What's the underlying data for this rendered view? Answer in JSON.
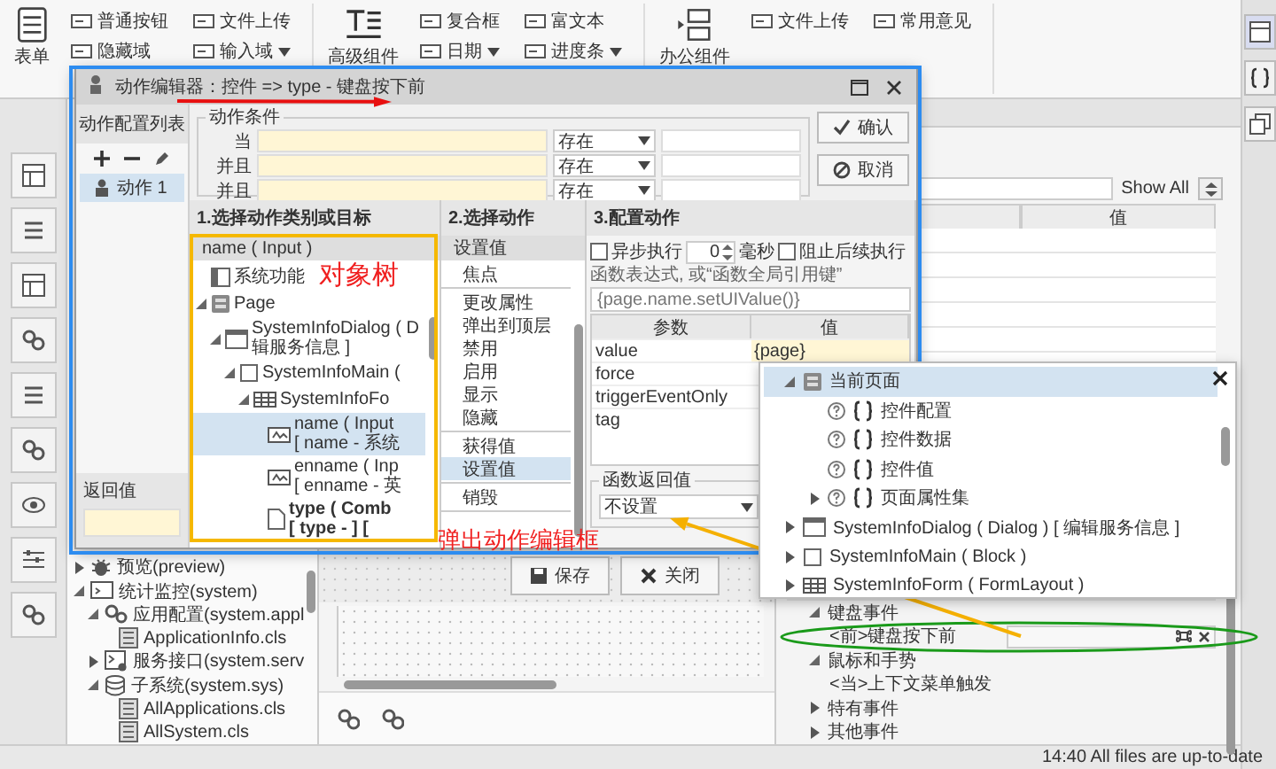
{
  "ribbon": {
    "groups": [
      {
        "label": "表单",
        "items": [
          {
            "label": "普通按钮",
            "has_menu": false
          },
          {
            "label": "文件上传",
            "has_menu": false
          },
          {
            "label": "隐藏域",
            "has_menu": false
          },
          {
            "label": "输入域",
            "has_menu": true
          }
        ]
      },
      {
        "label": "高级组件",
        "items": [
          {
            "label": "复合框",
            "has_menu": false
          },
          {
            "label": "富文本",
            "has_menu": false
          },
          {
            "label": "日期",
            "has_menu": true
          },
          {
            "label": "进度条",
            "has_menu": true
          }
        ]
      },
      {
        "label": "办公组件",
        "items": [
          {
            "label": "文件上传",
            "has_menu": false
          },
          {
            "label": "常用意见",
            "has_menu": false
          }
        ]
      }
    ]
  },
  "project_tree": {
    "items": [
      {
        "label": "预览(preview)",
        "kind": "preview",
        "expanded": false
      },
      {
        "label": "统计监控(system)",
        "kind": "monitor",
        "expanded": true,
        "children": [
          {
            "label": "应用配置(system.appl",
            "kind": "config",
            "expanded": true,
            "children": [
              {
                "label": "ApplicationInfo.cls",
                "kind": "class"
              }
            ]
          },
          {
            "label": "服务接口(system.serv",
            "kind": "service",
            "expanded": false
          },
          {
            "label": "子系统(system.sys)",
            "kind": "database",
            "expanded": true,
            "children": [
              {
                "label": "AllApplications.cls",
                "kind": "class"
              },
              {
                "label": "AllSystem.cls",
                "kind": "class"
              }
            ]
          }
        ]
      }
    ]
  },
  "properties": {
    "show_all": "Show All",
    "value_column": "值",
    "events": [
      {
        "label": "键盘事件",
        "kind": "group",
        "expanded": true
      },
      {
        "label": "<前>键盘按下前",
        "kind": "bound"
      },
      {
        "label": "鼠标和手势",
        "kind": "group",
        "expanded": true
      },
      {
        "label": "<当>上下文菜单触发",
        "kind": "event"
      },
      {
        "label": "特有事件",
        "kind": "group",
        "expanded": false
      },
      {
        "label": "其他事件",
        "kind": "group",
        "expanded": false
      }
    ]
  },
  "status_bar": {
    "text": "14:40 All files are up-to-date"
  },
  "dialog": {
    "title": "动作编辑器：控件 => type - 键盘按下前",
    "list_title": "动作配置列表",
    "actions": [
      {
        "label": "动作 1",
        "selected": true
      }
    ],
    "return_label": "返回值",
    "conditions": {
      "legend": "动作条件",
      "rows": [
        {
          "label": "当",
          "operator": "存在"
        },
        {
          "label": "并且",
          "operator": "存在"
        },
        {
          "label": "并且",
          "operator": "存在"
        }
      ]
    },
    "buttons": [
      {
        "label": "确认",
        "kind": "ok"
      },
      {
        "label": "取消",
        "kind": "cancel"
      }
    ],
    "target_panel": {
      "title": "1.选择动作类别或目标",
      "header": "name ( Input )",
      "tree": [
        {
          "label": "系统功能",
          "kind": "system",
          "selected": false
        },
        {
          "label": "Page",
          "kind": "page",
          "expanded": true,
          "selected": false,
          "children": [
            {
              "label": "SystemInfoDialog ( D",
              "sub": "辑服务信息 ]",
              "kind": "dialog",
              "expanded": true,
              "selected": false,
              "children": [
                {
                  "label": "SystemInfoMain (",
                  "kind": "block",
                  "expanded": true,
                  "selected": false,
                  "children": [
                    {
                      "label": "SystemInfoFo",
                      "kind": "form",
                      "expanded": true,
                      "selected": false,
                      "children": [
                        {
                          "label": "name ( Input",
                          "sub": "[ name - 系统",
                          "kind": "input",
                          "selected": true,
                          "current": false
                        },
                        {
                          "label": "enname ( Inp",
                          "sub": "[ enname - 英",
                          "kind": "input",
                          "selected": false,
                          "current": false
                        },
                        {
                          "label": "type ( Comb",
                          "sub": "[ type - ] [",
                          "kind": "combo",
                          "selected": false,
                          "current": true
                        }
                      ]
                    }
                  ]
                }
              ]
            }
          ]
        }
      ]
    },
    "action_panel": {
      "title": "2.选择动作",
      "header": "设置值",
      "groups": [
        [
          {
            "label": "焦点",
            "selected": false
          }
        ],
        [
          {
            "label": "更改属性",
            "selected": false
          },
          {
            "label": "弹出到顶层",
            "selected": false
          },
          {
            "label": "禁用",
            "selected": false
          },
          {
            "label": "启用",
            "selected": false
          },
          {
            "label": "显示",
            "selected": false
          },
          {
            "label": "隐藏",
            "selected": false
          }
        ],
        [
          {
            "label": "获得值",
            "selected": false
          },
          {
            "label": "设置值",
            "selected": true
          }
        ],
        [
          {
            "label": "销毁",
            "selected": false
          }
        ]
      ]
    },
    "config_panel": {
      "title": "3.配置动作",
      "async": {
        "label": "异步执行",
        "checked": false
      },
      "delay": "0",
      "unit": "毫秒",
      "stop": {
        "label": "阻止后续执行",
        "checked": false
      },
      "expr_label": "函数表达式, 或“函数全局引用键”",
      "expr_value": "{page.name.setUIValue()}",
      "columns": [
        "参数",
        "值"
      ],
      "params": [
        {
          "name": "value",
          "value": "{page}"
        },
        {
          "name": "force"
        },
        {
          "name": "triggerEventOnly"
        },
        {
          "name": "tag"
        }
      ],
      "return_legend": "函数返回值",
      "return_value": "不设置"
    }
  },
  "canvas": {
    "buttons": [
      {
        "label": "保存",
        "kind": "save"
      },
      {
        "label": "关闭",
        "kind": "close"
      }
    ]
  },
  "value_picker": {
    "items": [
      {
        "label": "当前页面",
        "kind": "page",
        "expanded": true,
        "selected": true,
        "children": [
          {
            "label": "控件配置",
            "kind": "object",
            "selected": false
          },
          {
            "label": "控件数据",
            "kind": "object",
            "selected": false
          },
          {
            "label": "控件值",
            "kind": "object",
            "selected": false
          },
          {
            "label": "页面属性集",
            "kind": "object",
            "expanded": false,
            "selected": false
          }
        ]
      },
      {
        "label": "SystemInfoDialog ( Dialog ) [ 编辑服务信息 ]",
        "kind": "dialog",
        "expanded": false,
        "selected": false
      },
      {
        "label": "SystemInfoMain ( Block )",
        "kind": "block",
        "expanded": false,
        "selected": false
      },
      {
        "label": "SystemInfoForm ( FormLayout )",
        "kind": "form",
        "expanded": false,
        "selected": false
      }
    ]
  },
  "annotations": [
    {
      "text": "对象树"
    },
    {
      "text": "弹出动作编辑框"
    }
  ]
}
